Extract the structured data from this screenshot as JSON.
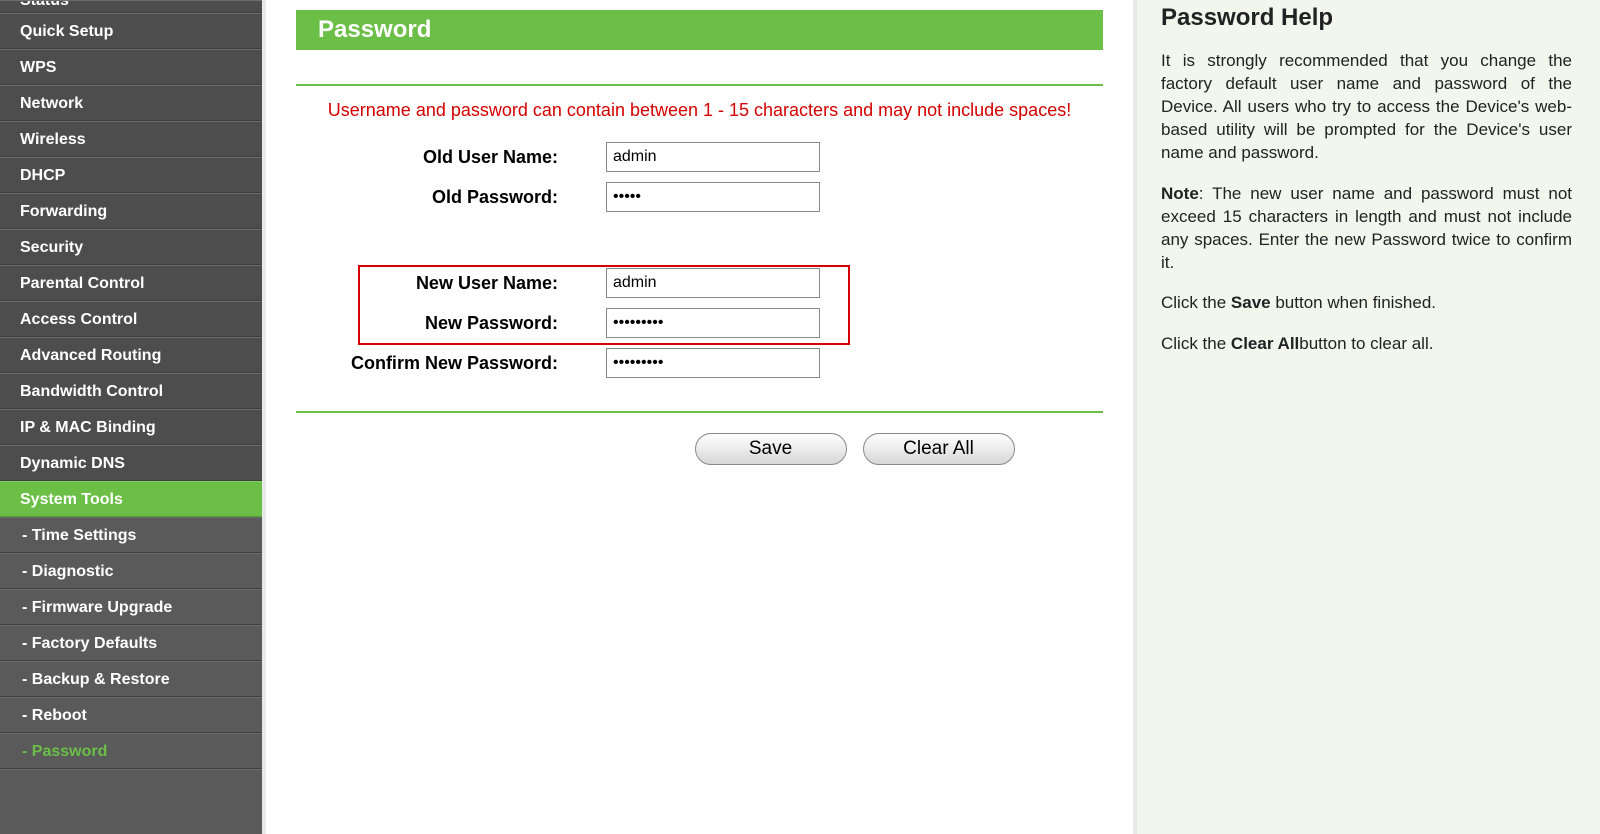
{
  "sidebar": {
    "items": [
      {
        "label": "Status",
        "kind": "item",
        "truncated": true
      },
      {
        "label": "Quick Setup",
        "kind": "item"
      },
      {
        "label": "WPS",
        "kind": "item"
      },
      {
        "label": "Network",
        "kind": "item"
      },
      {
        "label": "Wireless",
        "kind": "item"
      },
      {
        "label": "DHCP",
        "kind": "item"
      },
      {
        "label": "Forwarding",
        "kind": "item"
      },
      {
        "label": "Security",
        "kind": "item"
      },
      {
        "label": "Parental Control",
        "kind": "item"
      },
      {
        "label": "Access Control",
        "kind": "item"
      },
      {
        "label": "Advanced Routing",
        "kind": "item"
      },
      {
        "label": "Bandwidth Control",
        "kind": "item"
      },
      {
        "label": "IP & MAC Binding",
        "kind": "item"
      },
      {
        "label": "Dynamic DNS",
        "kind": "item"
      },
      {
        "label": "System Tools",
        "kind": "item",
        "active": true
      },
      {
        "label": "- Time Settings",
        "kind": "sub"
      },
      {
        "label": "- Diagnostic",
        "kind": "sub"
      },
      {
        "label": "- Firmware Upgrade",
        "kind": "sub"
      },
      {
        "label": "- Factory Defaults",
        "kind": "sub"
      },
      {
        "label": "- Backup & Restore",
        "kind": "sub"
      },
      {
        "label": "- Reboot",
        "kind": "sub"
      },
      {
        "label": "- Password",
        "kind": "sub",
        "current": true
      }
    ]
  },
  "page": {
    "title": "Password",
    "warning": "Username and password can contain between 1 - 15 characters and may not include spaces!",
    "fields": {
      "old_user_label": "Old User Name:",
      "old_user_value": "admin",
      "old_pass_label": "Old Password:",
      "old_pass_value": "•••••",
      "new_user_label": "New User Name:",
      "new_user_value": "admin",
      "new_pass_label": "New Password:",
      "new_pass_value": "•••••••••",
      "confirm_pass_label": "Confirm New Password:",
      "confirm_pass_value": "•••••••••"
    },
    "buttons": {
      "save": "Save",
      "clear": "Clear All"
    }
  },
  "help": {
    "title": "Password Help",
    "p1": "It is strongly recommended that you change the factory default user name and password of the Device. All users who try to access the Device's web-based utility will be prompted for the Device's user name and password.",
    "note_label": "Note",
    "p2": ": The new user name and password must not exceed 15 characters in length and must not include any spaces. Enter the new Password twice to confirm it.",
    "p3a": "Click the ",
    "p3b": "Save",
    "p3c": " button when finished.",
    "p4a": "Click the ",
    "p4b": "Clear All",
    "p4c": "button to clear all."
  }
}
